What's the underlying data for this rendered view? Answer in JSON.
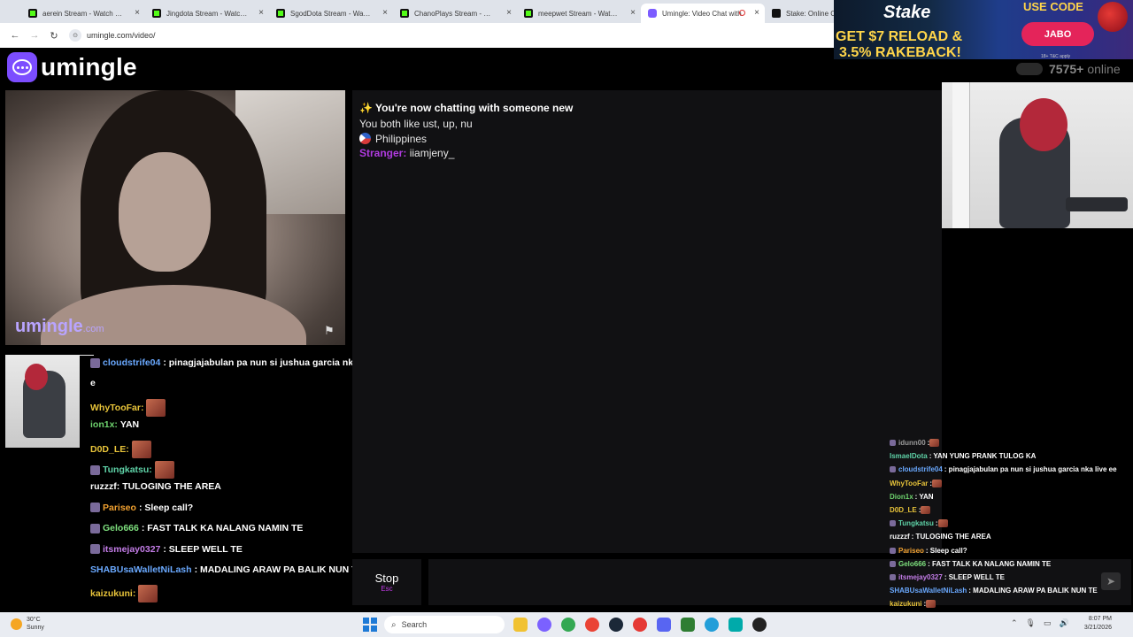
{
  "browser": {
    "tabs": [
      {
        "title": "aerein Stream - Watch Live o",
        "icon": "kick-icon",
        "active": false
      },
      {
        "title": "Jingdota Stream - Watch Live",
        "icon": "kick-icon",
        "active": false
      },
      {
        "title": "SgodDota Stream - Watch Li",
        "icon": "kick-icon",
        "active": false
      },
      {
        "title": "ChanoPlays Stream - Watch",
        "icon": "kick-icon",
        "active": false
      },
      {
        "title": "meepwet Stream - Watch Li",
        "icon": "kick-icon",
        "active": false
      },
      {
        "title": "Umingle: Video Chat with",
        "icon": "umingle-icon",
        "active": true
      },
      {
        "title": "Stake: Online Cas",
        "icon": "stake-icon",
        "active": false
      }
    ],
    "url": "umingle.com/video/"
  },
  "ad": {
    "brand": "Stake",
    "line1": "GET $7 RELOAD &",
    "line2": "3.5% RAKEBACK!",
    "use_code": "USE CODE",
    "code": "JABO",
    "fine_print": "18+ T&C apply"
  },
  "header": {
    "logo_text": "umingle",
    "online_count": "7575+",
    "online_label": "online"
  },
  "video": {
    "watermark_main": "umingle",
    "watermark_suffix": ".com"
  },
  "chat": {
    "system_new": "✨ You're now chatting with someone new",
    "common_interests": "You both like ust, up, nu",
    "country": "Philippines",
    "stranger_label": "Stranger:",
    "stranger_message": "iiamjeny_"
  },
  "controls": {
    "stop_label": "Stop",
    "stop_hint": "Esc",
    "message_placeholder": ""
  },
  "overlay_chat_left": [
    {
      "user": "cloudstrife04",
      "text": ": pinagjajabulan pa nun si jushua garcia nk",
      "color": "#6aa9ff",
      "badge": true
    },
    {
      "user": "",
      "text": "e",
      "color": "#ffffff",
      "badge": false
    },
    {
      "user": "WhyTooFar:",
      "text": "",
      "color": "#e8c43a",
      "badge": false,
      "emote": true
    },
    {
      "user": "ion1x:",
      "text": " YAN",
      "color": "#6ed36e",
      "badge": false
    },
    {
      "user": "D0D_LE:",
      "text": "",
      "color": "#e8c43a",
      "badge": false,
      "emote": true
    },
    {
      "user": "Tungkatsu:",
      "text": "",
      "color": "#5fd3a8",
      "badge": true,
      "emote": true
    },
    {
      "user": "ruzzzf:",
      "text": " TULOGING THE AREA",
      "color": "#ffffff",
      "badge": false
    },
    {
      "user": "Pariseo",
      "text": ": Sleep call?",
      "color": "#f0a030",
      "badge": true
    },
    {
      "user": "Gelo666",
      "text": ": FAST TALK KA NALANG NAMIN TE",
      "color": "#7ee07e",
      "badge": true
    },
    {
      "user": "itsmejay0327",
      "text": ": SLEEP WELL TE",
      "color": "#c47de8",
      "badge": true
    },
    {
      "user": "SHABUsaWalletNiLash",
      "text": ": MADALING ARAW PA BALIK NUN T",
      "color": "#6aa9ff",
      "badge": false
    },
    {
      "user": "kaizukuni:",
      "text": "",
      "color": "#e8c43a",
      "badge": false,
      "emote": true
    }
  ],
  "overlay_chat_right": [
    {
      "user": "idunn00",
      "text": " :",
      "color": "#9a9a9a",
      "badge": true,
      "emote": true
    },
    {
      "user": "IsmaelDota",
      "text": " : YAN YUNG PRANK TULOG KA",
      "color": "#5fd3a8",
      "badge": false
    },
    {
      "user": "cloudstrife04",
      "text": " : pinagjajabulan pa nun si jushua garcia nka live ee",
      "color": "#6aa9ff",
      "badge": true
    },
    {
      "user": "WhyTooFar",
      "text": " :",
      "color": "#e8c43a",
      "badge": false,
      "emote": true
    },
    {
      "user": "Dion1x",
      "text": " : YAN",
      "color": "#6ed36e",
      "badge": false
    },
    {
      "user": "D0D_LE",
      "text": " :",
      "color": "#e8c43a",
      "badge": false,
      "emote": true
    },
    {
      "user": "Tungkatsu",
      "text": " :",
      "color": "#5fd3a8",
      "badge": true,
      "emote": true
    },
    {
      "user": "ruzzzf",
      "text": " : TULOGING THE AREA",
      "color": "#ffffff",
      "badge": false
    },
    {
      "user": "Pariseo",
      "text": " : Sleep call?",
      "color": "#f0a030",
      "badge": true
    },
    {
      "user": "Gelo666",
      "text": " : FAST TALK KA NALANG NAMIN TE",
      "color": "#7ee07e",
      "badge": true
    },
    {
      "user": "itsmejay0327",
      "text": " : SLEEP WELL TE",
      "color": "#c47de8",
      "badge": true
    },
    {
      "user": "SHABUsaWalletNiLash",
      "text": " : MADALING ARAW PA BALIK NUN TE",
      "color": "#6aa9ff",
      "badge": false
    },
    {
      "user": "kaizukuni",
      "text": " :",
      "color": "#e8c43a",
      "badge": false,
      "emote": true
    }
  ],
  "taskbar": {
    "temp": "30°C",
    "condition": "Sunny",
    "search_placeholder": "Search",
    "time": "8:07 PM",
    "date": "3/21/2026"
  }
}
